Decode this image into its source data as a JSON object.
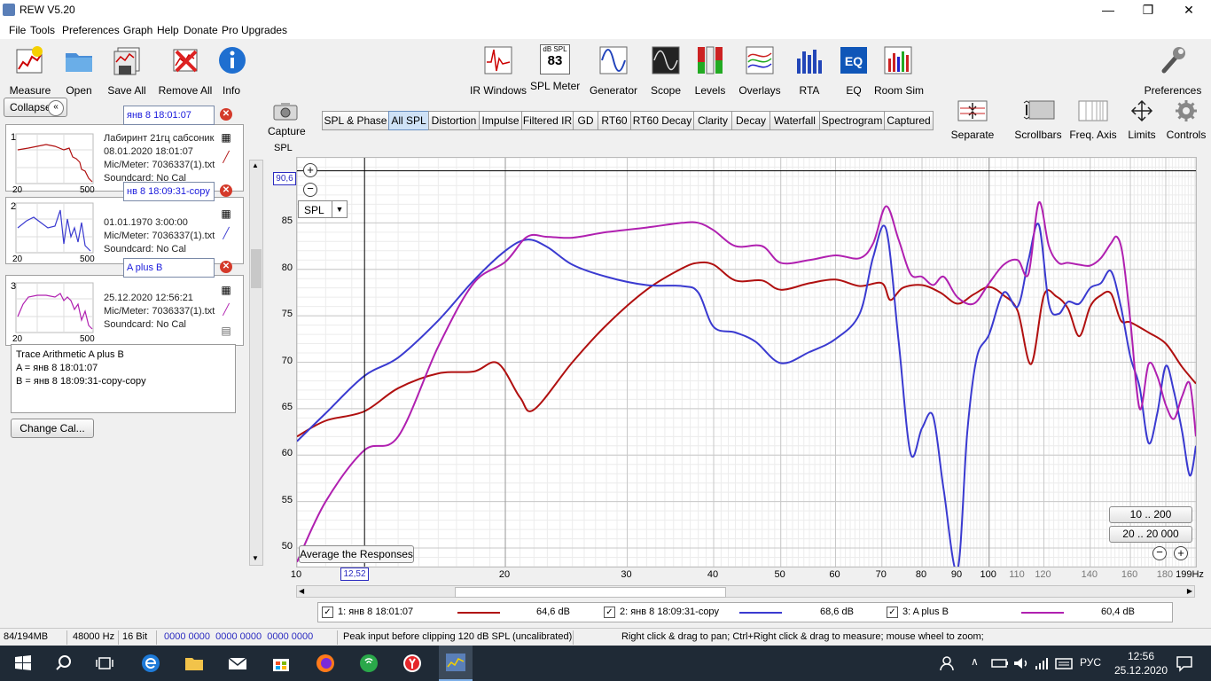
{
  "window": {
    "title": "REW V5.20",
    "minimize": "—",
    "restore": "❐",
    "close": "✕"
  },
  "menu": [
    "File",
    "Tools",
    "Preferences",
    "Graph",
    "Help",
    "Donate",
    "Pro Upgrades"
  ],
  "toolbar_left": [
    "Measure",
    "Open",
    "Save All",
    "Remove All",
    "Info"
  ],
  "toolbar_mid": [
    "IR Windows",
    "SPL Meter",
    "Generator",
    "Scope",
    "Levels",
    "Overlays",
    "RTA",
    "EQ",
    "Room Sim"
  ],
  "spl_meter_icon": {
    "top": "dB SPL",
    "value": "83"
  },
  "toolbar_right": "Preferences",
  "collapse_label": "Collapse",
  "measurements": [
    {
      "num": "1",
      "name": "янв 8 18:01:07",
      "desc": "Лабиринт 21гц сабсоник",
      "date": "08.01.2020 18:01:07",
      "meter": "Mic/Meter: 7036337(1).txt",
      "card": "Soundcard: No Cal",
      "thumb_x0": "20",
      "thumb_x1": "500",
      "color": "#b01010"
    },
    {
      "num": "2",
      "name": "нв 8 18:09:31-copy",
      "desc": "",
      "date": "01.01.1970 3:00:00",
      "meter": "Mic/Meter: 7036337(1).txt",
      "card": "Soundcard: No Cal",
      "thumb_x0": "20",
      "thumb_x1": "500",
      "color": "#3a3ad0"
    },
    {
      "num": "3",
      "name": "A plus B",
      "desc": "",
      "date": "25.12.2020 12:56:21",
      "meter": "Mic/Meter: 7036337(1).txt",
      "card": "Soundcard: No Cal",
      "thumb_x0": "20",
      "thumb_x1": "500",
      "color": "#b020b0"
    }
  ],
  "notes": [
    "Trace Arithmetic A plus B",
    "A = янв 8 18:01:07",
    "B = янв 8 18:09:31-copy-copy"
  ],
  "change_cal": "Change Cal...",
  "capture_label": "Capture",
  "spl_axis_label": "SPL",
  "tabs": [
    "SPL & Phase",
    "All SPL",
    "Distortion",
    "Impulse",
    "Filtered IR",
    "GD",
    "RT60",
    "RT60 Decay",
    "Clarity",
    "Decay",
    "Waterfall",
    "Spectrogram",
    "Captured"
  ],
  "selected_tab": "All SPL",
  "right_controls": [
    "Separate",
    "Scrollbars",
    "Freq. Axis",
    "Limits",
    "Controls"
  ],
  "graph": {
    "cursor_y_value": "90,6",
    "cursor_x_value": "12,52",
    "select_value": "SPL",
    "average_button": "Average the Responses",
    "range_buttons": [
      "10 .. 200",
      "20 .. 20 000"
    ]
  },
  "chart_data": {
    "type": "line",
    "xscale": "log",
    "xlim": [
      10,
      199
    ],
    "ylim": [
      48,
      92
    ],
    "ylabel": "SPL",
    "xlabel": "",
    "y_ticks": [
      "85",
      "80",
      "75",
      "70",
      "65",
      "60",
      "55",
      "50"
    ],
    "x_ticks": [
      "10",
      "20",
      "30",
      "40",
      "50",
      "60",
      "70",
      "80",
      "90",
      "100",
      "110",
      "120",
      "140",
      "160",
      "180",
      "199Hz"
    ],
    "grid": true,
    "series": [
      {
        "name": "1: янв 8 18:01:07",
        "color": "#b01010",
        "level": "64,6 dB",
        "x": [
          10,
          11,
          12.5,
          14,
          16,
          18,
          19.5,
          21,
          22,
          25,
          28,
          32,
          36,
          38,
          40,
          43,
          47,
          50,
          55,
          60,
          65,
          70,
          72,
          75,
          80,
          85,
          90,
          95,
          100,
          105,
          110,
          115,
          120,
          125,
          130,
          135,
          140,
          145,
          150,
          155,
          160,
          170,
          180,
          190,
          199
        ],
        "y": [
          62,
          63.7,
          64.7,
          67.2,
          68.8,
          69,
          69.9,
          66.2,
          64.9,
          70,
          74,
          77.8,
          80.1,
          80.7,
          80.5,
          78.8,
          78.8,
          77.8,
          78.5,
          78.9,
          78.2,
          78.5,
          76.7,
          78,
          78.3,
          77.5,
          76.3,
          77.3,
          78.1,
          77.2,
          75.5,
          69.8,
          77.2,
          77.1,
          75.8,
          72.8,
          76,
          77.2,
          77.4,
          74.5,
          74.3,
          73.2,
          72,
          69.5,
          67.7
        ]
      },
      {
        "name": "2: янв 8 18:09:31-copy",
        "color": "#3a3ad0",
        "level": "68,6 dB",
        "x": [
          10,
          11,
          12.5,
          14,
          16,
          18,
          20,
          21.5,
          23,
          25,
          28,
          32,
          36,
          38,
          40,
          43,
          46,
          50,
          55,
          60,
          65,
          68,
          71,
          74,
          77,
          80,
          83,
          86,
          90,
          93,
          96,
          100,
          105,
          110,
          114,
          118,
          122,
          126,
          130,
          135,
          140,
          145,
          150,
          155,
          160,
          165,
          170,
          175,
          180,
          185,
          190,
          195,
          199
        ],
        "y": [
          61.5,
          64.5,
          68.5,
          70.5,
          74.5,
          78.8,
          82,
          83.2,
          82.4,
          80.5,
          79.2,
          78.3,
          78.2,
          77.5,
          73.8,
          73.2,
          72.2,
          69.9,
          71.1,
          72.5,
          75.2,
          81.3,
          84.3,
          72.3,
          60.2,
          62.9,
          64.2,
          56.2,
          47.6,
          62.5,
          70.5,
          73,
          77.5,
          76,
          81,
          84.8,
          76.3,
          75.2,
          76.5,
          76.3,
          78,
          78.5,
          79.8,
          76,
          70.6,
          67.3,
          61.3,
          64.5,
          69.6,
          66.8,
          62.6,
          57.8,
          61
        ]
      },
      {
        "name": "3: A plus B",
        "color": "#b020b0",
        "level": "60,4 dB",
        "x": [
          10,
          11,
          12.5,
          14,
          16,
          18,
          20,
          21.5,
          23,
          25,
          28,
          32,
          36,
          38,
          40,
          43,
          47,
          50,
          55,
          60,
          65,
          68,
          71,
          74,
          77,
          80,
          83,
          86,
          90,
          95,
          100,
          105,
          110,
          114,
          118,
          122,
          126,
          130,
          135,
          140,
          145,
          150,
          153,
          156,
          160,
          165,
          170,
          175,
          180,
          185,
          190,
          195,
          199
        ],
        "y": [
          48.5,
          55,
          60.5,
          62,
          71.7,
          78.5,
          80.8,
          83.5,
          83.5,
          83.4,
          84,
          84.5,
          85,
          85,
          84.2,
          82.5,
          82.5,
          80.7,
          81,
          81.5,
          81.2,
          82.8,
          86.8,
          83.2,
          79.5,
          79.2,
          78.3,
          79.2,
          77,
          76.3,
          78.5,
          80.5,
          81,
          79.5,
          87.2,
          82.5,
          80.7,
          80.7,
          80.5,
          80.4,
          81.2,
          82.8,
          83.5,
          81.5,
          74.5,
          65,
          69.8,
          68.5,
          65.4,
          63.9,
          66.3,
          67.7,
          62
        ]
      }
    ]
  },
  "status": {
    "memory": "84/194MB",
    "rate": "48000 Hz",
    "bits": "16 Bit",
    "levels": "0000 0000  0000 0000  0000 0000",
    "peak": "Peak input before clipping 120 dB SPL (uncalibrated)",
    "hint": "Right click & drag to pan; Ctrl+Right click & drag to measure; mouse wheel to zoom;"
  },
  "tray": {
    "lang": "РУС",
    "time": "12:56",
    "date": "25.12.2020"
  }
}
